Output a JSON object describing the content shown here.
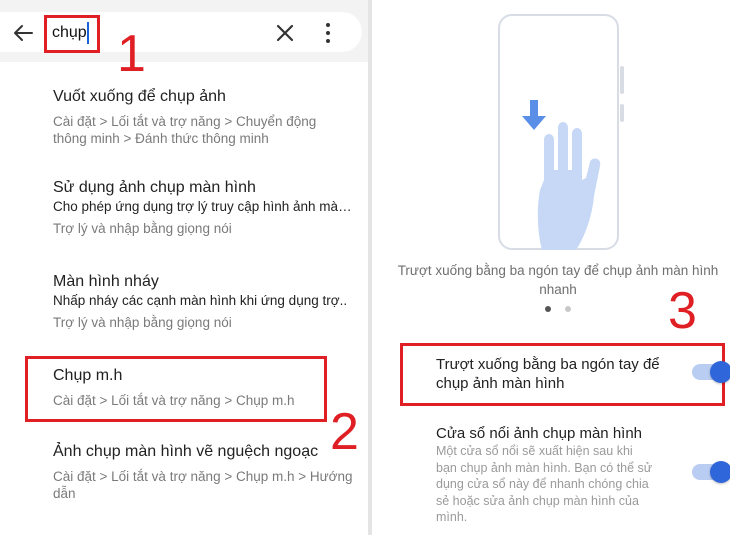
{
  "search": {
    "query": "chụp"
  },
  "markers": {
    "m1": "1",
    "m2": "2",
    "m3": "3"
  },
  "results": [
    {
      "title": "Vuốt xuống để chụp ảnh",
      "path_line1": "Cài đặt > Lối tắt và trợ năng > Chuyển động",
      "path_line2": "thông minh > Đánh thức thông minh"
    },
    {
      "title": "Sử dụng ảnh chụp màn hình",
      "desc": "Cho phép ứng dụng trợ lý truy cập hình ảnh màn..",
      "path": "Trợ lý và nhập bằng giọng nói"
    },
    {
      "title": "Màn hình nháy",
      "desc": "Nhấp nháy các cạnh màn hình khi ứng dụng trợ..",
      "path": "Trợ lý và nhập bằng giọng nói"
    },
    {
      "title": "Chụp m.h",
      "path": "Cài đặt > Lối tắt và trợ năng > Chụp m.h"
    },
    {
      "title": "Ảnh chụp màn hình vẽ nguệch ngoạc",
      "path_line1": "Cài đặt > Lối tắt và trợ năng > Chụp m.h > Hướng",
      "path_line2": "dẫn"
    }
  ],
  "settings": {
    "caption_line1": "Trượt xuống bằng ba ngón tay để chụp ảnh màn hình",
    "caption_line2": "nhanh",
    "option1": {
      "title_line1": "Trượt xuống bằng ba ngón tay để",
      "title_line2": "chụp ảnh màn hình",
      "enabled": true
    },
    "option2": {
      "title": "Cửa sổ nổi ảnh chụp màn hình",
      "desc_lines": [
        "Một cửa sổ nổi sẽ xuất hiện sau khi",
        "bạn chụp ảnh màn hình. Bạn có thể sử",
        "dụng cửa sổ này để nhanh chóng chia",
        "sẻ hoặc sửa ảnh chụp màn hình của",
        "mình."
      ],
      "enabled": true
    }
  },
  "colors": {
    "annotation_red": "#e01f25",
    "toggle_blue": "#2f66d9",
    "illustration_blue": "#c6d8f6"
  }
}
